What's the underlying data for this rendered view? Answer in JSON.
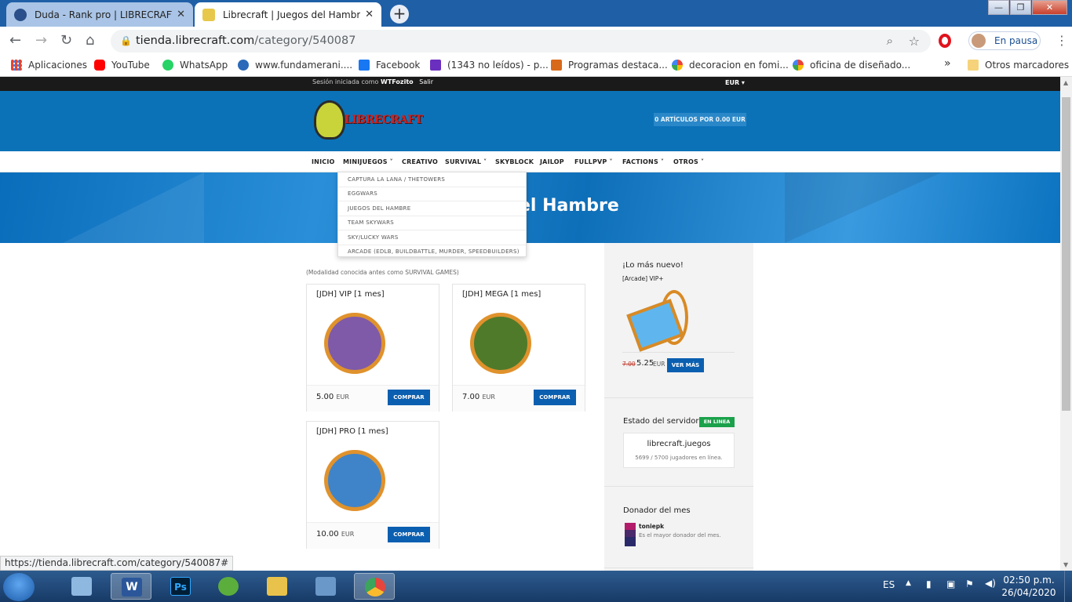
{
  "browser": {
    "tabs": [
      {
        "title": "Duda - Rank pro | LIBRECRAFT » ",
        "active": false
      },
      {
        "title": "Librecraft | Juegos del Hambre",
        "active": true
      }
    ],
    "close_glyph": "✕",
    "new_tab": "+",
    "window_buttons": {
      "minimize": "—",
      "maximize": "❐",
      "close": "✕"
    },
    "url_host": "tienda.librecraft.com",
    "url_path": "/category/540087",
    "profile_label": "En pausa",
    "bookmarks": [
      {
        "label": "Aplicaciones",
        "icon": "apps-grid-icon",
        "color": "#e8442e"
      },
      {
        "label": "YouTube",
        "icon": "youtube-icon",
        "color": "#ff0000"
      },
      {
        "label": "WhatsApp",
        "icon": "whatsapp-icon",
        "color": "#25d366"
      },
      {
        "label": "www.fundamerani....",
        "icon": "site-icon",
        "color": "#2a6ab8"
      },
      {
        "label": "Facebook",
        "icon": "facebook-icon",
        "color": "#1877f2"
      },
      {
        "label": "(1343 no leídos) - p...",
        "icon": "mail-icon",
        "color": "#6b2fbf"
      },
      {
        "label": "Programas destaca...",
        "icon": "fox-icon",
        "color": "#d9691a"
      },
      {
        "label": "decoracion en fomi...",
        "icon": "google-icon",
        "color": "#4285f4"
      },
      {
        "label": "oficina de diseñado...",
        "icon": "google-icon",
        "color": "#4285f4"
      }
    ],
    "more_bookmarks": "»",
    "other_bookmarks": "Otros marcadores",
    "status_url": "https://tienda.librecraft.com/category/540087#"
  },
  "site": {
    "session_text": "Sesión iniciada como",
    "session_user": "WTFozito",
    "logout": "Salir",
    "currency": "EUR ▾",
    "logo_text": "LIBRECRAFT",
    "cart": "0 ARTÍCULOS POR 0.00 EUR",
    "nav": [
      {
        "label": "INICIO"
      },
      {
        "label": "MINIJUEGOS ˅"
      },
      {
        "label": "CREATIVO"
      },
      {
        "label": "SURVIVAL ˅"
      },
      {
        "label": "SKYBLOCK"
      },
      {
        "label": "JAILOP"
      },
      {
        "label": "FULLPVP ˅"
      },
      {
        "label": "FACTIONS ˅"
      },
      {
        "label": "OTROS ˅"
      }
    ],
    "dropdown": [
      "CAPTURA LA LANA / THETOWERS",
      "EGGWARS",
      "JUEGOS DEL HAMBRE",
      "TEAM SKYWARS",
      "SKY/LUCKY WARS",
      "ARCADE (EDLB, BUILDBATTLE, MURDER, SPEEDBUILDERS)"
    ],
    "banner_title": "el Hambre",
    "category_note": "(Modalidad conocida antes como SURVIVAL GAMES)",
    "products": [
      {
        "title": "[JDH] VIP [1 mes]",
        "price": "5.00",
        "currency": "EUR",
        "button": "COMPRAR",
        "color": "#7e5aa8"
      },
      {
        "title": "[JDH] MEGA [1 mes]",
        "price": "7.00",
        "currency": "EUR",
        "button": "COMPRAR",
        "color": "#4f7a2a"
      },
      {
        "title": "[JDH] PRO [1 mes]",
        "price": "10.00",
        "currency": "EUR",
        "button": "COMPRAR",
        "color": "#3f84c8"
      }
    ],
    "sidebar": {
      "new_heading": "¡Lo más nuevo!",
      "new_item": "[Arcade] VIP+",
      "old_price": "7.00",
      "new_price": "5.25",
      "new_currency": "EUR",
      "more_button": "VER MÁS",
      "server_heading": "Estado del servidor",
      "server_badge": "EN LINEA",
      "server_host": "librecraft.juegos",
      "server_players": "5699 / 5700 jugadores en línea.",
      "donor_heading": "Donador del mes",
      "donor_name": "toniepk",
      "donor_text": "Es el mayor donador del mes."
    }
  },
  "taskbar": {
    "apps": [
      {
        "name": "calculator",
        "color": "#8fb8e0"
      },
      {
        "name": "word",
        "color": "#2b579a"
      },
      {
        "name": "photoshop",
        "color": "#001e36"
      },
      {
        "name": "corel",
        "color": "#5cae3c"
      },
      {
        "name": "explorer",
        "color": "#e8c24a"
      },
      {
        "name": "network",
        "color": "#6a98c8"
      },
      {
        "name": "chrome",
        "color": "#e8453c"
      }
    ],
    "word_label": "W",
    "ps_label": "Ps",
    "lang": "ES",
    "time": "02:50 p.m.",
    "date": "26/04/2020"
  }
}
